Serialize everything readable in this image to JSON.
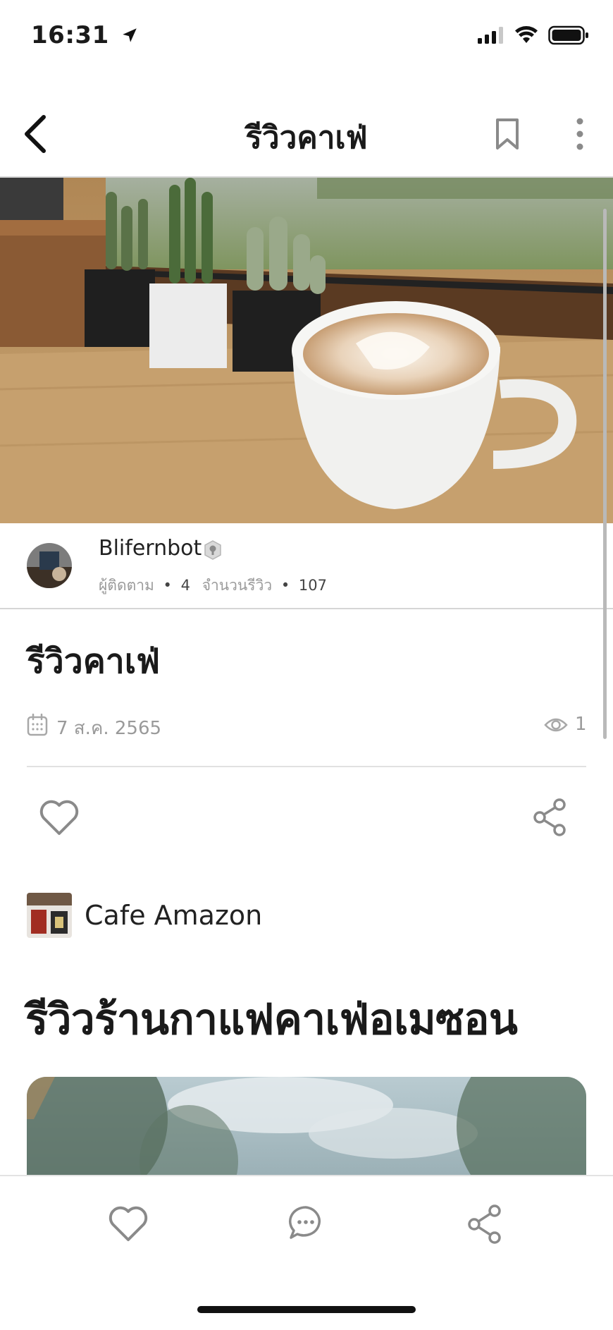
{
  "status_bar": {
    "time": "16:31",
    "icons": [
      "location-arrow-icon",
      "signal-icon",
      "wifi-icon",
      "battery-icon"
    ]
  },
  "header": {
    "title": "รีวิวคาเฟ่",
    "icons": [
      "back-chevron-icon",
      "bookmark-icon",
      "more-vertical-icon"
    ]
  },
  "author": {
    "name": "Blifernbot",
    "followers_label": "ผู้ติดตาม",
    "followers_count": "4",
    "reviews_label": "จำนวนรีวิว",
    "reviews_count": "107",
    "separator": "•"
  },
  "post": {
    "title": "รีวิวคาเฟ่",
    "date": "7 ส.ค. 2565",
    "views": "1",
    "shop_name": "Cafe Amazon",
    "headline": "รีวิวร้านกาแฟคาเฟ่อเมซอน"
  },
  "bottom_bar": {
    "icons": [
      "heart-icon",
      "comment-icon",
      "share-icon"
    ]
  },
  "colors": {
    "text": "#1a1a1a",
    "muted": "#9a9a9a",
    "icon_gray": "#8a8a8a",
    "divider": "#d5d5d5"
  }
}
